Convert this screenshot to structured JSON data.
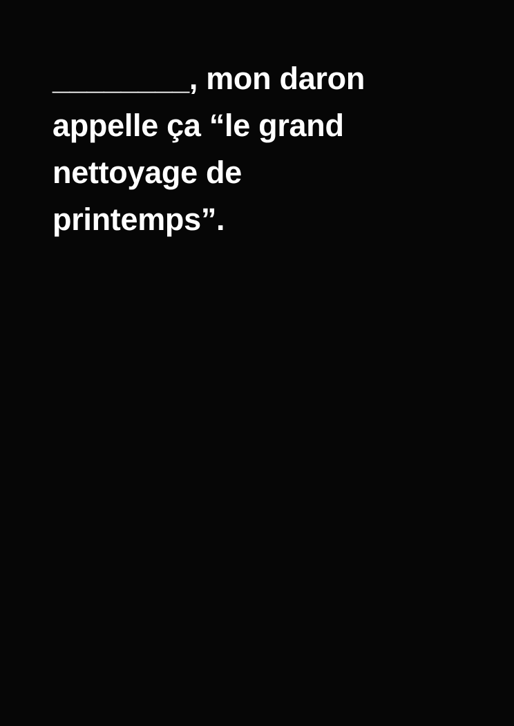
{
  "card": {
    "lines": [
      "________, mon daron",
      "appelle ça “le grand",
      "nettoyage de",
      "printemps”."
    ]
  },
  "colors": {
    "background": "#060606",
    "text": "#ffffff"
  }
}
